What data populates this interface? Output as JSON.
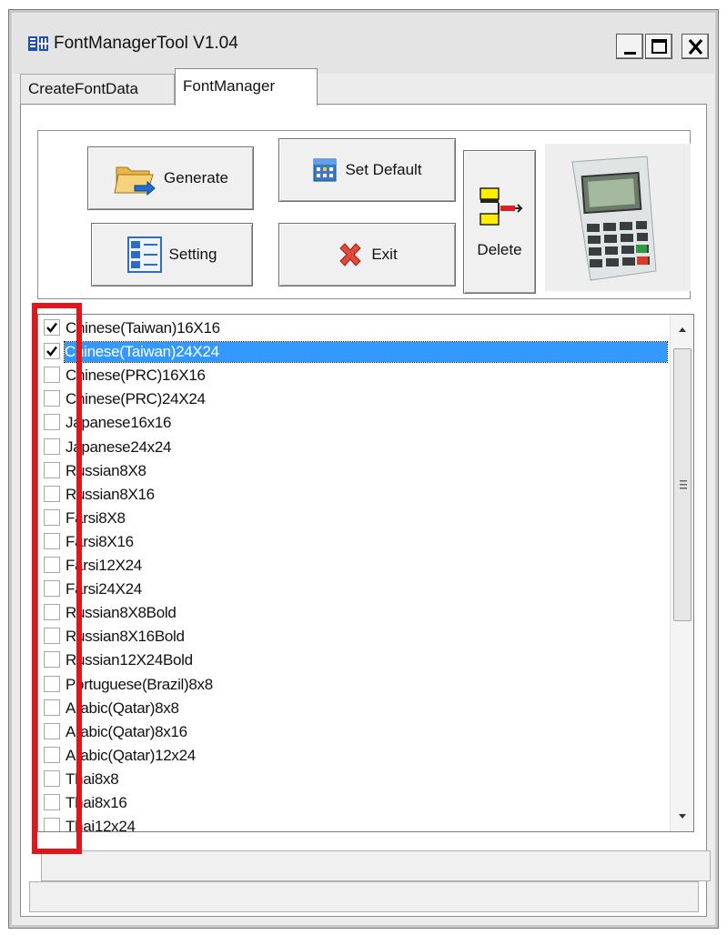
{
  "window": {
    "title": "FontManagerTool V1.04",
    "controls": [
      "minimize",
      "maximize",
      "close"
    ]
  },
  "tabs": [
    {
      "label": "CreateFontData",
      "active": false
    },
    {
      "label": "FontManager",
      "active": true
    }
  ],
  "toolbar": {
    "generate_label": "Generate",
    "set_default_label": "Set Default",
    "setting_label": "Setting",
    "exit_label": "Exit",
    "delete_label": "Delete"
  },
  "font_list": {
    "items": [
      {
        "label": "Chinese(Taiwan)16X16",
        "checked": true,
        "selected": false
      },
      {
        "label": "Chinese(Taiwan)24X24",
        "checked": true,
        "selected": true
      },
      {
        "label": "Chinese(PRC)16X16",
        "checked": false,
        "selected": false
      },
      {
        "label": "Chinese(PRC)24X24",
        "checked": false,
        "selected": false
      },
      {
        "label": "Japanese16x16",
        "checked": false,
        "selected": false
      },
      {
        "label": "Japanese24x24",
        "checked": false,
        "selected": false
      },
      {
        "label": "Russian8X8",
        "checked": false,
        "selected": false
      },
      {
        "label": "Russian8X16",
        "checked": false,
        "selected": false
      },
      {
        "label": "Farsi8X8",
        "checked": false,
        "selected": false
      },
      {
        "label": "Farsi8X16",
        "checked": false,
        "selected": false
      },
      {
        "label": "Farsi12X24",
        "checked": false,
        "selected": false
      },
      {
        "label": "Farsi24X24",
        "checked": false,
        "selected": false
      },
      {
        "label": "Russian8X8Bold",
        "checked": false,
        "selected": false
      },
      {
        "label": "Russian8X16Bold",
        "checked": false,
        "selected": false
      },
      {
        "label": "Russian12X24Bold",
        "checked": false,
        "selected": false
      },
      {
        "label": "Portuguese(Brazil)8x8",
        "checked": false,
        "selected": false
      },
      {
        "label": "Arabic(Qatar)8x8",
        "checked": false,
        "selected": false
      },
      {
        "label": "Arabic(Qatar)8x16",
        "checked": false,
        "selected": false
      },
      {
        "label": "Arabic(Qatar)12x24",
        "checked": false,
        "selected": false
      },
      {
        "label": "Thai8x8",
        "checked": false,
        "selected": false
      },
      {
        "label": "Thai8x16",
        "checked": false,
        "selected": false
      },
      {
        "label": "Thai12x24",
        "checked": false,
        "selected": false
      }
    ]
  },
  "status_bar": {
    "primary": "",
    "secondary": ""
  },
  "colors": {
    "selection": "#3399ff",
    "annotation_box": "#e0161b",
    "window_bg": "#ececec"
  },
  "icons": {
    "app": "app-icon",
    "generate": "folder-arrow-icon",
    "set_default": "calendar-grid-icon",
    "setting": "settings-list-icon",
    "exit": "red-x-icon",
    "delete": "delete-arrow-icon",
    "device": "pos-terminal-image"
  }
}
